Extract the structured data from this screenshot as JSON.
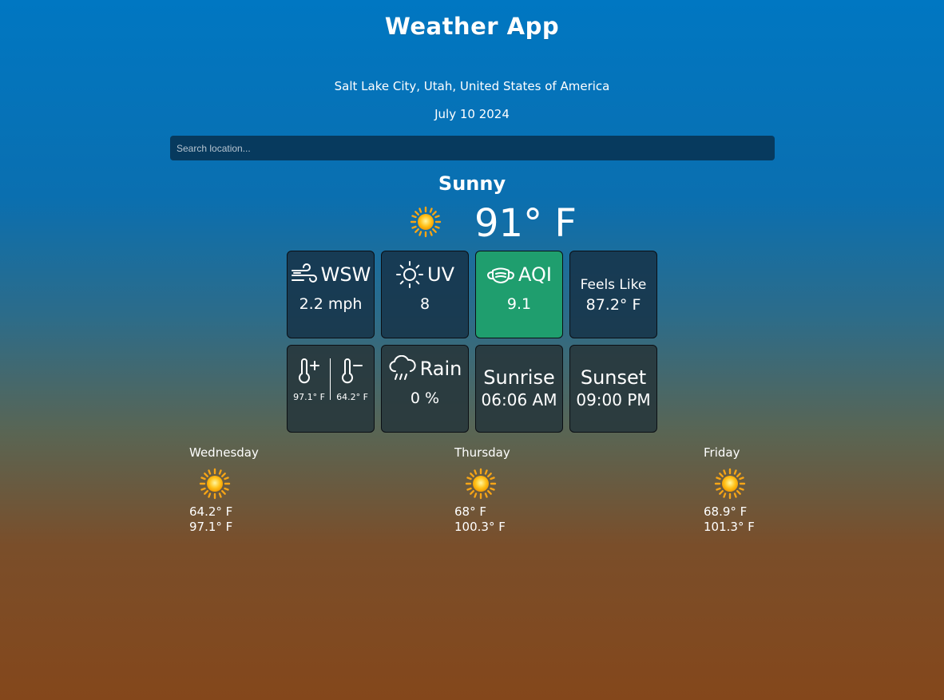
{
  "app": {
    "title": "Weather App"
  },
  "location": "Salt Lake City, Utah, United States of America",
  "date": "July 10 2024",
  "search": {
    "placeholder": "Search location..."
  },
  "current": {
    "condition": "Sunny",
    "temperature": "91° F",
    "icon": "sun-icon"
  },
  "tiles": {
    "wind": {
      "direction": "WSW",
      "speed": "2.2 mph",
      "icon": "wind-icon"
    },
    "uv": {
      "label": "UV",
      "value": "8",
      "icon": "sun-outline-icon"
    },
    "aqi": {
      "label": "AQI",
      "value": "9.1",
      "icon": "mask-icon",
      "color": "#1f9e6e"
    },
    "feels_like": {
      "label": "Feels Like",
      "value": "87.2° F"
    },
    "high_low": {
      "high": "97.1° F",
      "low": "64.2° F",
      "high_icon": "thermometer-plus-icon",
      "low_icon": "thermometer-minus-icon"
    },
    "rain": {
      "label": "Rain",
      "value": "0 %",
      "icon": "rain-cloud-icon"
    },
    "sunrise": {
      "label": "Sunrise",
      "value": "06:06 AM"
    },
    "sunset": {
      "label": "Sunset",
      "value": "09:00 PM"
    }
  },
  "forecast": [
    {
      "day": "Wednesday",
      "low": "64.2° F",
      "high": "97.1° F",
      "icon": "sun-icon"
    },
    {
      "day": "Thursday",
      "low": "68° F",
      "high": "100.3° F",
      "icon": "sun-icon"
    },
    {
      "day": "Friday",
      "low": "68.9° F",
      "high": "101.3° F",
      "icon": "sun-icon"
    }
  ]
}
